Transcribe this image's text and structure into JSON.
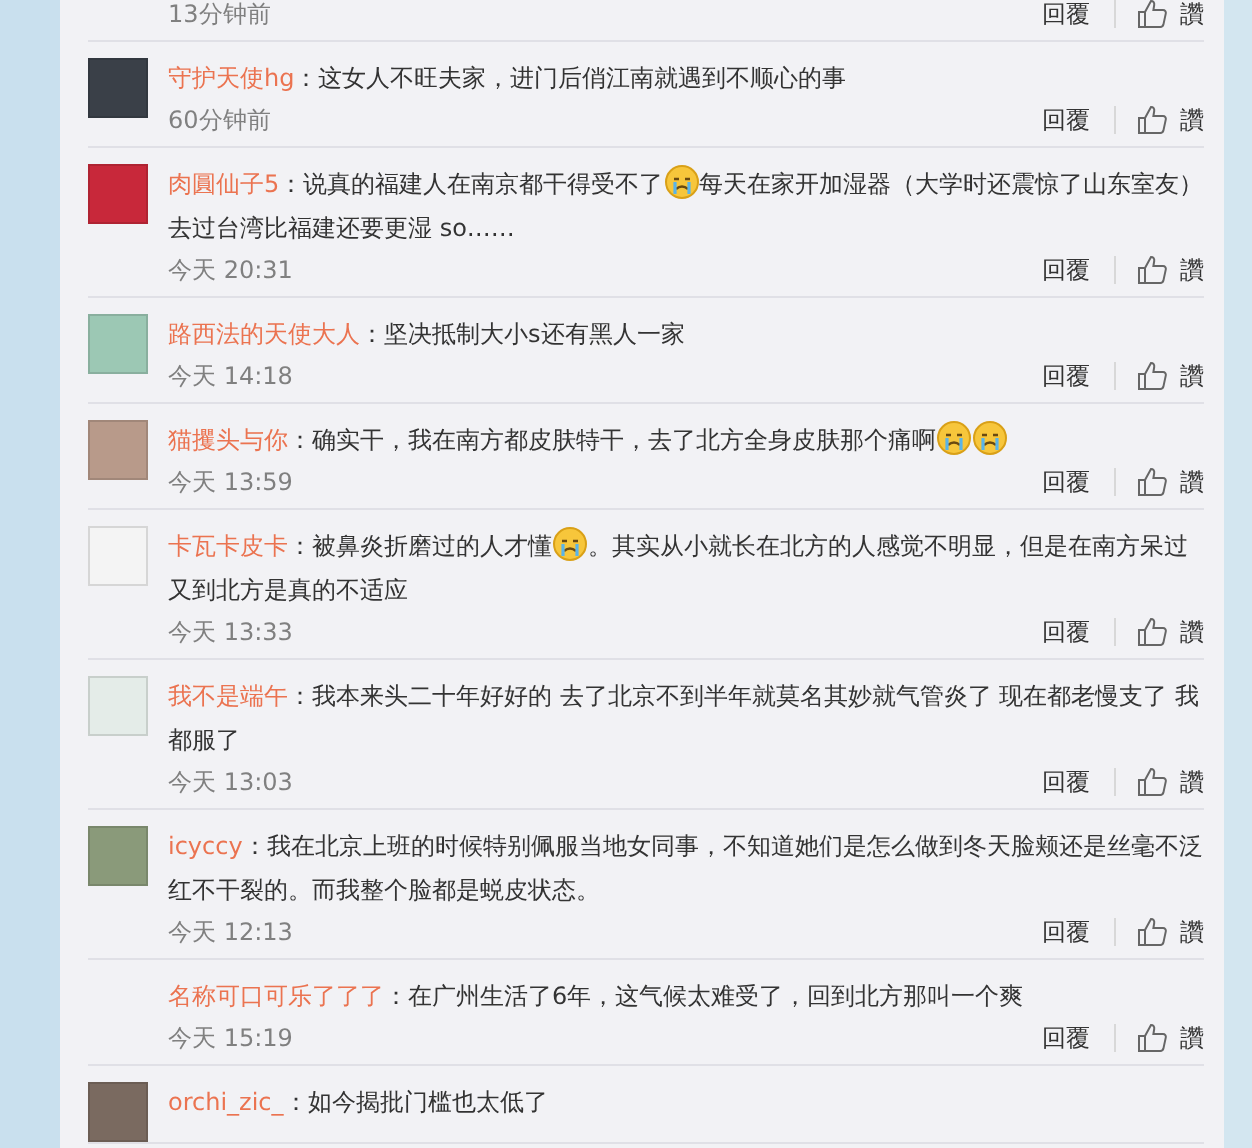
{
  "comments": [
    {
      "partial": true,
      "time": "13分钟前",
      "reply": "回覆",
      "like": "讚"
    },
    {
      "name": "守护天使hg",
      "color": "#3a4048",
      "parts": [
        {
          "kind": "text",
          "text": "：这女人不旺夫家，进门后俏江南就遇到不顺心的事"
        }
      ],
      "time": "60分钟前",
      "reply": "回覆",
      "like": "讚"
    },
    {
      "name": "肉圓仙子5",
      "color": "#c8283a",
      "parts": [
        {
          "kind": "text",
          "text": "：说真的福建人在南京都干得受不了"
        },
        {
          "kind": "emoji"
        },
        {
          "kind": "text",
          "text": "每天在家开加湿器（大学时还震惊了山东室友）去过台湾比福建还要更湿 so……"
        }
      ],
      "time": "今天 20:31",
      "reply": "回覆",
      "like": "讚"
    },
    {
      "name": "路西法的天使大人",
      "color": "#9cc8b4",
      "parts": [
        {
          "kind": "text",
          "text": "：坚决抵制大小s还有黑人一家"
        }
      ],
      "time": "今天 14:18",
      "reply": "回覆",
      "like": "讚"
    },
    {
      "name": "猫攫头与你",
      "color": "#b89a8a",
      "parts": [
        {
          "kind": "text",
          "text": "：确实干，我在南方都皮肤特干，去了北方全身皮肤那个痛啊"
        },
        {
          "kind": "emoji"
        },
        {
          "kind": "emoji"
        }
      ],
      "time": "今天 13:59",
      "reply": "回覆",
      "like": "讚"
    },
    {
      "name": "卡瓦卡皮卡",
      "color": "#f4f4f4",
      "parts": [
        {
          "kind": "text",
          "text": "：被鼻炎折磨过的人才懂"
        },
        {
          "kind": "emoji"
        },
        {
          "kind": "text",
          "text": "。其实从小就长在北方的人感觉不明显，但是在南方呆过又到北方是真的不适应"
        }
      ],
      "time": "今天 13:33",
      "reply": "回覆",
      "like": "讚"
    },
    {
      "name": "我不是端午",
      "color": "#e4ece8",
      "parts": [
        {
          "kind": "text",
          "text": "：我本来头二十年好好的 去了北京不到半年就莫名其妙就气管炎了 现在都老慢支了 我都服了"
        }
      ],
      "time": "今天 13:03",
      "reply": "回覆",
      "like": "讚"
    },
    {
      "name": "icyccy",
      "color": "#8a9a7a",
      "parts": [
        {
          "kind": "text",
          "text": "：我在北京上班的时候特别佩服当地女同事，不知道她们是怎么做到冬天脸颊还是丝毫不泛红不干裂的。而我整个脸都是蜕皮状态。"
        }
      ],
      "time": "今天 12:13",
      "reply": "回覆",
      "like": "讚"
    },
    {
      "name": "名称可口可乐了了了",
      "parts": [
        {
          "kind": "text",
          "text": "：在广州生活了6年，这气候太难受了，回到北方那叫一个爽"
        }
      ],
      "time": "今天 15:19",
      "reply": "回覆",
      "like": "讚"
    },
    {
      "name": "orchi_zic_",
      "color": "#7a6a60",
      "parts": [
        {
          "kind": "text",
          "text": "：如今揭批门槛也太低了"
        }
      ]
    }
  ]
}
